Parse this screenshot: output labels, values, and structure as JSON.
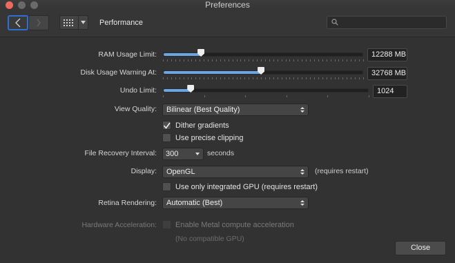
{
  "window": {
    "title": "Preferences"
  },
  "toolbar": {
    "section_title": "Performance",
    "back_icon": "chevron-left-icon",
    "forward_icon": "chevron-right-icon",
    "grid_icon": "grid-icon",
    "search_icon": "search-icon",
    "search_placeholder": "",
    "search_value": ""
  },
  "colors": {
    "accent": "#6aa5e6",
    "focus_ring": "#2f6fd1",
    "close_window": "#ed6a5e"
  },
  "settings": {
    "ram": {
      "label": "RAM Usage Limit:",
      "value": "12288 MB",
      "fraction": 0.19
    },
    "disk": {
      "label": "Disk Usage Warning At:",
      "value": "32768 MB",
      "fraction": 0.49
    },
    "undo": {
      "label": "Undo Limit:",
      "value": "1024",
      "fraction": 0.135
    },
    "view_quality": {
      "label": "View Quality:",
      "value": "Bilinear (Best Quality)"
    },
    "dither": {
      "label": "Dither gradients",
      "checked": true
    },
    "precise_clipping": {
      "label": "Use precise clipping",
      "checked": false
    },
    "file_recovery": {
      "label": "File Recovery Interval:",
      "value": "300",
      "unit": "seconds"
    },
    "display": {
      "label": "Display:",
      "value": "OpenGL",
      "note": "(requires restart)"
    },
    "integrated_gpu": {
      "label": "Use only integrated GPU (requires restart)",
      "checked": false
    },
    "retina": {
      "label": "Retina Rendering:",
      "value": "Automatic (Best)"
    },
    "hardware_accel": {
      "label": "Hardware Acceleration:",
      "option": "Enable Metal compute acceleration",
      "note": "(No compatible GPU)",
      "checked": false,
      "enabled": false
    }
  },
  "buttons": {
    "close": "Close"
  }
}
